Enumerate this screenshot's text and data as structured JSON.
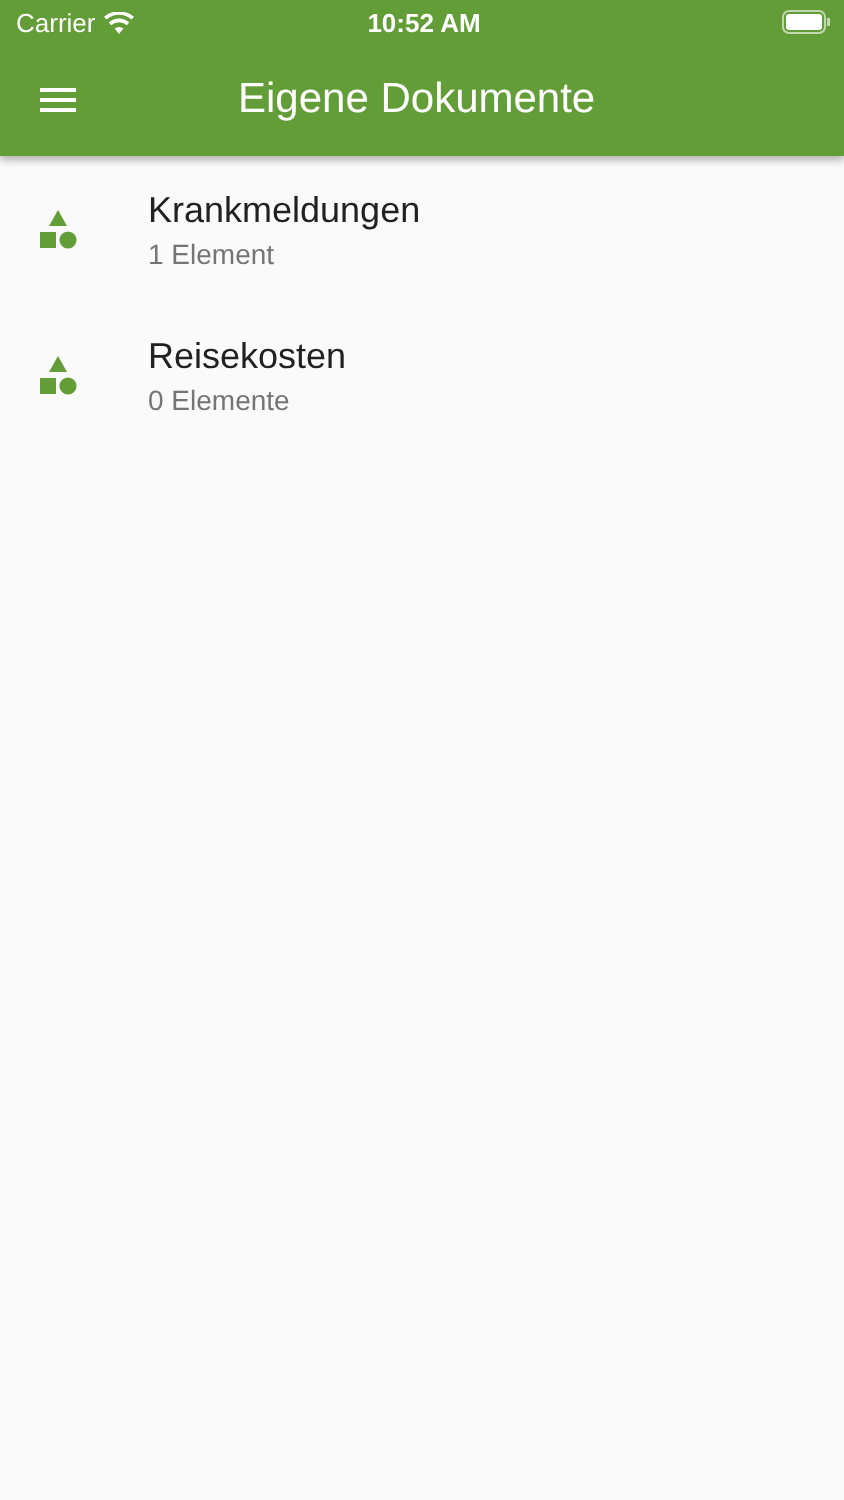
{
  "status_bar": {
    "carrier": "Carrier",
    "time": "10:52 AM"
  },
  "app_bar": {
    "title": "Eigene Dokumente"
  },
  "items": [
    {
      "title": "Krankmeldungen",
      "subtitle": "1 Element"
    },
    {
      "title": "Reisekosten",
      "subtitle": "0 Elemente"
    }
  ]
}
